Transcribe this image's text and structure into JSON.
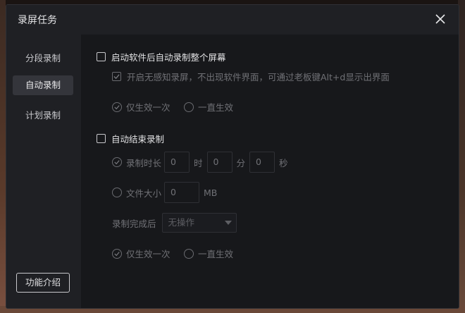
{
  "dialog": {
    "title": "录屏任务"
  },
  "sidebar": {
    "items": [
      {
        "label": "分段录制",
        "active": false
      },
      {
        "label": "自动录制",
        "active": true
      },
      {
        "label": "计划录制",
        "active": false
      }
    ],
    "feature_button": "功能介绍"
  },
  "auto_start": {
    "label": "启动软件后自动录制整个屏幕",
    "checked": false,
    "silent": {
      "label": "开启无感知录屏，不出现软件界面，可通过老板键Alt+d显示出界面",
      "checked": true,
      "disabled": true
    },
    "effect_options": [
      {
        "label": "仅生效一次",
        "selected": true
      },
      {
        "label": "一直生效",
        "selected": false
      }
    ]
  },
  "auto_stop": {
    "label": "自动结束录制",
    "checked": false,
    "duration": {
      "label": "录制时长",
      "selected": true,
      "hours": "0",
      "hours_unit": "时",
      "minutes": "0",
      "minutes_unit": "分",
      "seconds": "0",
      "seconds_unit": "秒"
    },
    "filesize": {
      "label": "文件大小",
      "selected": false,
      "value": "0",
      "unit": "MB"
    },
    "after_complete": {
      "label": "录制完成后",
      "selected_value": "无操作"
    },
    "effect_options": [
      {
        "label": "仅生效一次",
        "selected": true
      },
      {
        "label": "一直生效",
        "selected": false
      }
    ]
  },
  "colors": {
    "dialog_bg": "#1f2024",
    "content_bg": "#17181b",
    "active_nav_bg": "#34353b",
    "text": "#e2e2e4",
    "disabled_text": "#707176"
  }
}
